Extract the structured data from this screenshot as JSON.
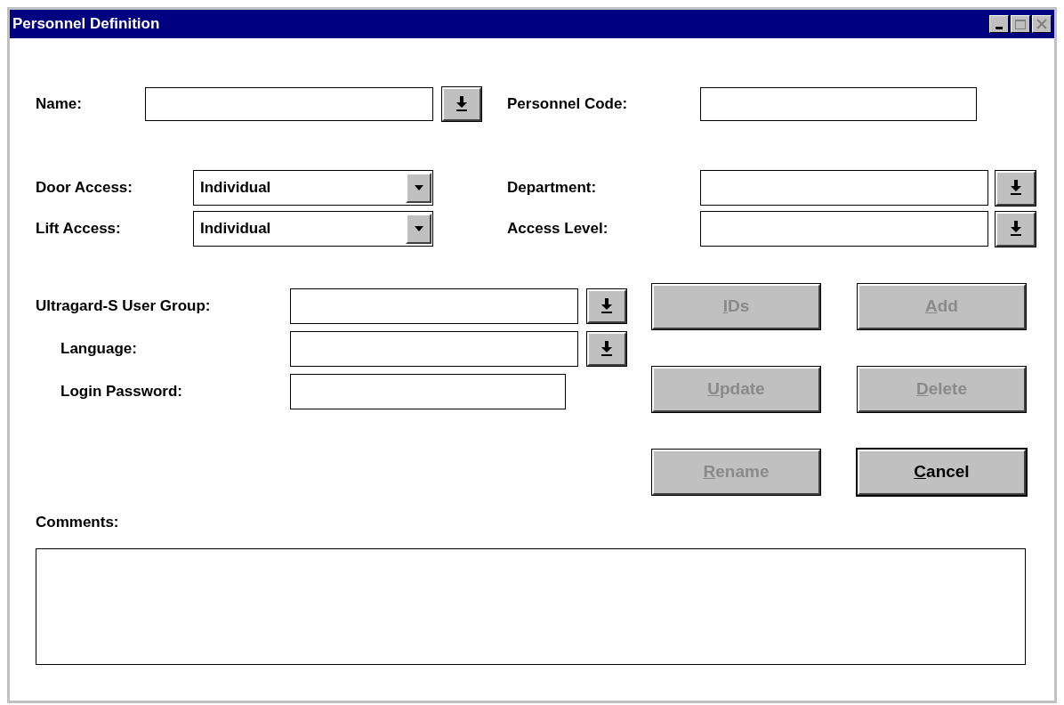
{
  "window": {
    "title": "Personnel Definition"
  },
  "top_fields": [
    {
      "label": "Name:",
      "kind": "lookup"
    },
    {
      "label": "Personnel Code:",
      "kind": "text"
    }
  ],
  "access_rows": [
    {
      "label": "Door Access:",
      "value": "Individual",
      "right_label": "Department:"
    },
    {
      "label": "Lift Access:",
      "value": "Individual",
      "right_label": "Access Level:"
    }
  ],
  "user_fields": [
    {
      "label": "Ultragard-S User Group:",
      "kind": "lookup",
      "indented": false
    },
    {
      "label": "Language:",
      "kind": "lookup",
      "indented": true
    },
    {
      "label": "Login Password:",
      "kind": "text",
      "indented": true
    }
  ],
  "buttons": [
    {
      "label": "IDs",
      "first_letter_underlined": true,
      "disabled": true
    },
    {
      "label": "Add",
      "first_letter_underlined": true,
      "disabled": true
    },
    {
      "label": "Update",
      "first_letter_underlined": true,
      "disabled": true
    },
    {
      "label": "Delete",
      "first_letter_underlined": true,
      "disabled": true
    },
    {
      "label": "Rename",
      "first_letter_underlined": true,
      "disabled": true
    },
    {
      "label": "Cancel",
      "first_letter_underlined": true,
      "disabled": false
    }
  ],
  "comments": {
    "label": "Comments:"
  }
}
